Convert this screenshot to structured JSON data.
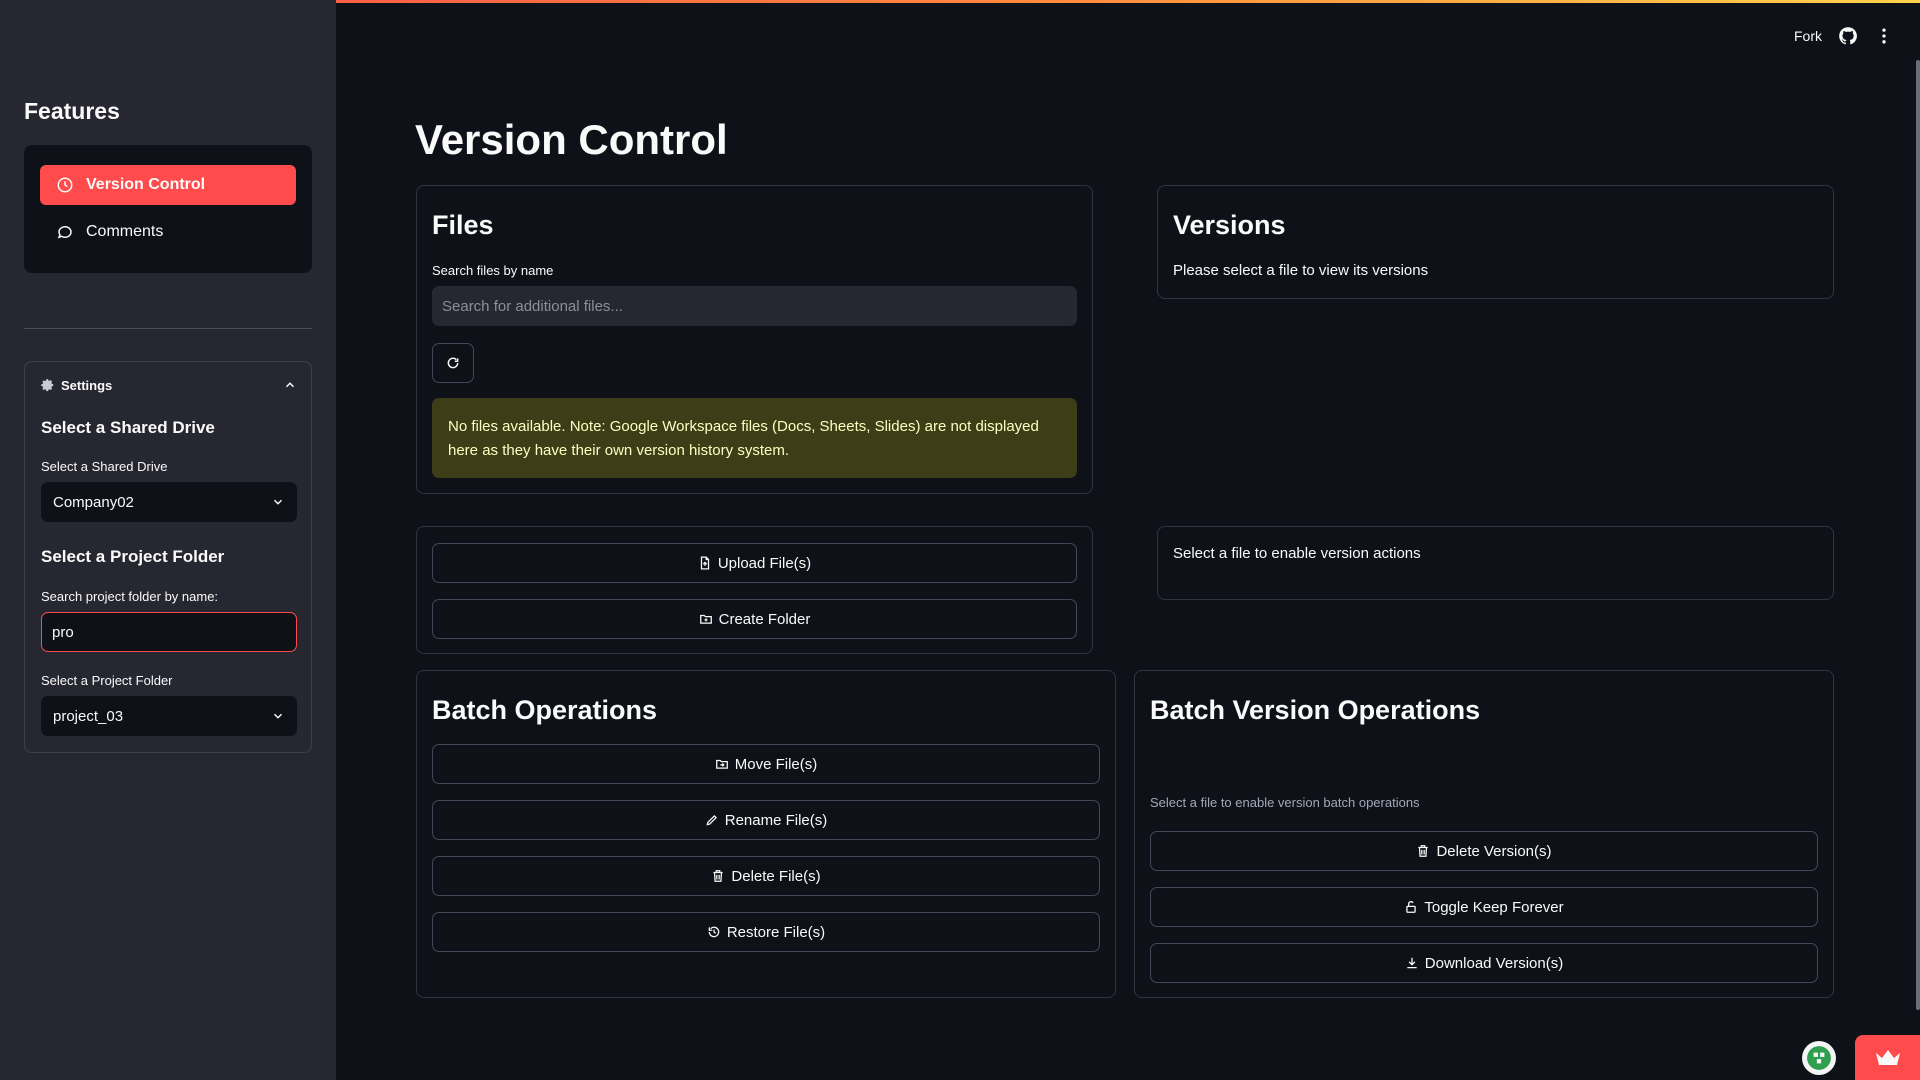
{
  "header": {
    "fork_label": "Fork",
    "github_icon": "github-icon",
    "menu_icon": "more-vertical-icon"
  },
  "sidebar": {
    "title": "Features",
    "nav": [
      {
        "label": "Version Control",
        "icon": "history-icon",
        "active": true
      },
      {
        "label": "Comments",
        "icon": "comment-icon",
        "active": false
      }
    ],
    "settings": {
      "title": "Settings",
      "shared_drive": {
        "subheader": "Select a Shared Drive",
        "label": "Select a Shared Drive",
        "value": "Company02"
      },
      "project_folder": {
        "subheader": "Select a Project Folder",
        "search_label": "Search project folder by name:",
        "search_value": "pro",
        "select_label": "Select a Project Folder",
        "value": "project_03"
      }
    }
  },
  "main": {
    "title": "Version Control",
    "files": {
      "title": "Files",
      "search_label": "Search files by name",
      "search_placeholder": "Search for additional files...",
      "warning": "No files available. Note: Google Workspace files (Docs, Sheets, Slides) are not displayed here as they have their own version history system."
    },
    "versions": {
      "title": "Versions",
      "message": "Please select a file to view its versions"
    },
    "file_actions": {
      "upload": "Upload File(s)",
      "create_folder": "Create Folder"
    },
    "version_actions": {
      "message": "Select a file to enable version actions"
    },
    "batch": {
      "title": "Batch Operations",
      "move": "Move File(s)",
      "rename": "Rename File(s)",
      "delete": "Delete File(s)",
      "restore": "Restore File(s)"
    },
    "batch_versions": {
      "title": "Batch Version Operations",
      "message": "Select a file to enable version batch operations",
      "delete": "Delete Version(s)",
      "keep": "Toggle Keep Forever",
      "download": "Download Version(s)"
    }
  },
  "colors": {
    "accent": "#ff4b4b",
    "background": "#0e1117",
    "sidebar": "#262730",
    "warning_bg": "#3d3d18",
    "warning_text": "#ffffc2"
  }
}
